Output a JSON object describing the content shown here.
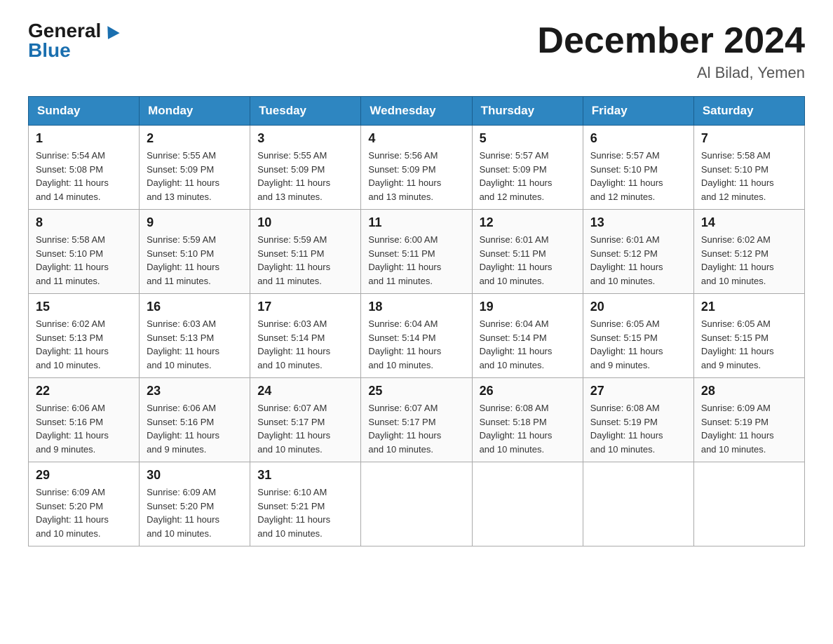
{
  "header": {
    "logo_general": "General",
    "logo_blue": "Blue",
    "month_title": "December 2024",
    "location": "Al Bilad, Yemen"
  },
  "days_of_week": [
    "Sunday",
    "Monday",
    "Tuesday",
    "Wednesday",
    "Thursday",
    "Friday",
    "Saturday"
  ],
  "weeks": [
    [
      {
        "day": "1",
        "sunrise": "5:54 AM",
        "sunset": "5:08 PM",
        "daylight": "11 hours and 14 minutes."
      },
      {
        "day": "2",
        "sunrise": "5:55 AM",
        "sunset": "5:09 PM",
        "daylight": "11 hours and 13 minutes."
      },
      {
        "day": "3",
        "sunrise": "5:55 AM",
        "sunset": "5:09 PM",
        "daylight": "11 hours and 13 minutes."
      },
      {
        "day": "4",
        "sunrise": "5:56 AM",
        "sunset": "5:09 PM",
        "daylight": "11 hours and 13 minutes."
      },
      {
        "day": "5",
        "sunrise": "5:57 AM",
        "sunset": "5:09 PM",
        "daylight": "11 hours and 12 minutes."
      },
      {
        "day": "6",
        "sunrise": "5:57 AM",
        "sunset": "5:10 PM",
        "daylight": "11 hours and 12 minutes."
      },
      {
        "day": "7",
        "sunrise": "5:58 AM",
        "sunset": "5:10 PM",
        "daylight": "11 hours and 12 minutes."
      }
    ],
    [
      {
        "day": "8",
        "sunrise": "5:58 AM",
        "sunset": "5:10 PM",
        "daylight": "11 hours and 11 minutes."
      },
      {
        "day": "9",
        "sunrise": "5:59 AM",
        "sunset": "5:10 PM",
        "daylight": "11 hours and 11 minutes."
      },
      {
        "day": "10",
        "sunrise": "5:59 AM",
        "sunset": "5:11 PM",
        "daylight": "11 hours and 11 minutes."
      },
      {
        "day": "11",
        "sunrise": "6:00 AM",
        "sunset": "5:11 PM",
        "daylight": "11 hours and 11 minutes."
      },
      {
        "day": "12",
        "sunrise": "6:01 AM",
        "sunset": "5:11 PM",
        "daylight": "11 hours and 10 minutes."
      },
      {
        "day": "13",
        "sunrise": "6:01 AM",
        "sunset": "5:12 PM",
        "daylight": "11 hours and 10 minutes."
      },
      {
        "day": "14",
        "sunrise": "6:02 AM",
        "sunset": "5:12 PM",
        "daylight": "11 hours and 10 minutes."
      }
    ],
    [
      {
        "day": "15",
        "sunrise": "6:02 AM",
        "sunset": "5:13 PM",
        "daylight": "11 hours and 10 minutes."
      },
      {
        "day": "16",
        "sunrise": "6:03 AM",
        "sunset": "5:13 PM",
        "daylight": "11 hours and 10 minutes."
      },
      {
        "day": "17",
        "sunrise": "6:03 AM",
        "sunset": "5:14 PM",
        "daylight": "11 hours and 10 minutes."
      },
      {
        "day": "18",
        "sunrise": "6:04 AM",
        "sunset": "5:14 PM",
        "daylight": "11 hours and 10 minutes."
      },
      {
        "day": "19",
        "sunrise": "6:04 AM",
        "sunset": "5:14 PM",
        "daylight": "11 hours and 10 minutes."
      },
      {
        "day": "20",
        "sunrise": "6:05 AM",
        "sunset": "5:15 PM",
        "daylight": "11 hours and 9 minutes."
      },
      {
        "day": "21",
        "sunrise": "6:05 AM",
        "sunset": "5:15 PM",
        "daylight": "11 hours and 9 minutes."
      }
    ],
    [
      {
        "day": "22",
        "sunrise": "6:06 AM",
        "sunset": "5:16 PM",
        "daylight": "11 hours and 9 minutes."
      },
      {
        "day": "23",
        "sunrise": "6:06 AM",
        "sunset": "5:16 PM",
        "daylight": "11 hours and 9 minutes."
      },
      {
        "day": "24",
        "sunrise": "6:07 AM",
        "sunset": "5:17 PM",
        "daylight": "11 hours and 10 minutes."
      },
      {
        "day": "25",
        "sunrise": "6:07 AM",
        "sunset": "5:17 PM",
        "daylight": "11 hours and 10 minutes."
      },
      {
        "day": "26",
        "sunrise": "6:08 AM",
        "sunset": "5:18 PM",
        "daylight": "11 hours and 10 minutes."
      },
      {
        "day": "27",
        "sunrise": "6:08 AM",
        "sunset": "5:19 PM",
        "daylight": "11 hours and 10 minutes."
      },
      {
        "day": "28",
        "sunrise": "6:09 AM",
        "sunset": "5:19 PM",
        "daylight": "11 hours and 10 minutes."
      }
    ],
    [
      {
        "day": "29",
        "sunrise": "6:09 AM",
        "sunset": "5:20 PM",
        "daylight": "11 hours and 10 minutes."
      },
      {
        "day": "30",
        "sunrise": "6:09 AM",
        "sunset": "5:20 PM",
        "daylight": "11 hours and 10 minutes."
      },
      {
        "day": "31",
        "sunrise": "6:10 AM",
        "sunset": "5:21 PM",
        "daylight": "11 hours and 10 minutes."
      },
      null,
      null,
      null,
      null
    ]
  ],
  "labels": {
    "sunrise": "Sunrise:",
    "sunset": "Sunset:",
    "daylight": "Daylight:"
  }
}
